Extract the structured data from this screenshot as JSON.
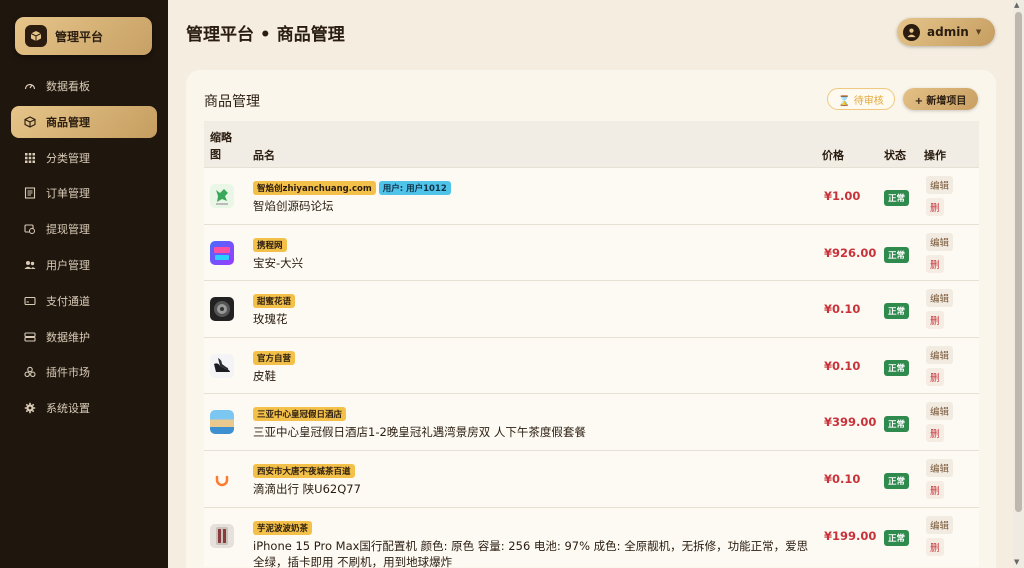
{
  "sidebar": {
    "brand": "管理平台",
    "items": [
      {
        "label": "数据看板",
        "icon": "dashboard-icon",
        "active": false
      },
      {
        "label": "商品管理",
        "icon": "box-icon",
        "active": true
      },
      {
        "label": "分类管理",
        "icon": "grid-icon",
        "active": false
      },
      {
        "label": "订单管理",
        "icon": "list-icon",
        "active": false
      },
      {
        "label": "提现管理",
        "icon": "withdraw-icon",
        "active": false
      },
      {
        "label": "用户管理",
        "icon": "users-icon",
        "active": false
      },
      {
        "label": "支付通道",
        "icon": "card-icon",
        "active": false
      },
      {
        "label": "数据维护",
        "icon": "database-icon",
        "active": false
      },
      {
        "label": "插件市场",
        "icon": "plugin-icon",
        "active": false
      },
      {
        "label": "系统设置",
        "icon": "gear-icon",
        "active": false
      }
    ]
  },
  "header": {
    "title": "管理平台 • 商品管理",
    "user": "admin"
  },
  "panel": {
    "title": "商品管理",
    "pending_label": "⌛ 待审核",
    "add_label": "+ 新增项目",
    "columns": {
      "thumb": "缩略图",
      "name": "品名",
      "price": "价格",
      "status": "状态",
      "actions": "操作"
    },
    "edit_label": "编辑",
    "delete_label": "删",
    "rows": [
      {
        "tags": [
          "智焰创zhiyanchuang.com",
          "用户: 用户1012"
        ],
        "name": "智焰创源码论坛",
        "price": "¥1.00",
        "status": "正常",
        "thumb": "green"
      },
      {
        "tags": [
          "携程网"
        ],
        "name": "宝安-大兴",
        "price": "¥926.00",
        "status": "正常",
        "thumb": "blue"
      },
      {
        "tags": [
          "甜蜜花语"
        ],
        "name": "玫瑰花",
        "price": "¥0.10",
        "status": "正常",
        "thumb": "dark"
      },
      {
        "tags": [
          "官方自营"
        ],
        "name": "皮鞋",
        "price": "¥0.10",
        "status": "正常",
        "thumb": "shoe"
      },
      {
        "tags": [
          "三亚中心皇冠假日酒店"
        ],
        "name": "三亚中心皇冠假日酒店1-2晚皇冠礼遇湾景房双 人下午茶度假套餐",
        "price": "¥399.00",
        "status": "正常",
        "thumb": "hotel"
      },
      {
        "tags": [
          "西安市大唐不夜城茶百道"
        ],
        "name": "滴滴出行 陕U62Q77",
        "price": "¥0.10",
        "status": "正常",
        "thumb": "didi"
      },
      {
        "tags": [
          "芋泥波波奶茶"
        ],
        "name": "iPhone 15 Pro Max国行配置机 颜色: 原色 容量: 256 电池: 97% 成色: 全原靓机，无拆修，功能正常，爱思全绿，插卡即用 不刷机，用到地球爆炸",
        "price": "¥199.00",
        "status": "正常",
        "thumb": "phone"
      }
    ]
  },
  "colors": {
    "accent": "#d7b274",
    "sidebar_bg": "#1f160e",
    "price": "#c8333a",
    "status": "#2f8a4e"
  }
}
